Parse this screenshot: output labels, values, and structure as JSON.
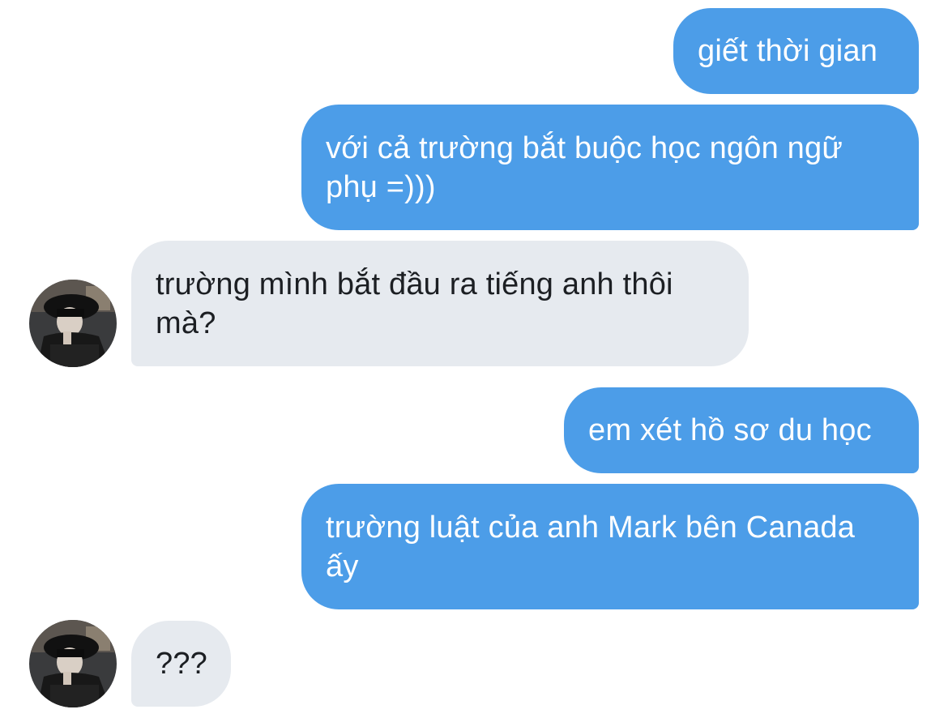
{
  "conversation": {
    "messages": [
      {
        "sender": "me",
        "text": "giết thời gian"
      },
      {
        "sender": "me",
        "text": "với cả trường bắt buộc học ngôn ngữ phụ =)))"
      },
      {
        "sender": "other",
        "text": "trường mình bắt đầu ra tiếng anh thôi mà?"
      },
      {
        "sender": "me",
        "text": "em xét hồ sơ du học"
      },
      {
        "sender": "me",
        "text": "trường luật của anh Mark bên Canada ấy"
      },
      {
        "sender": "other",
        "text": "???"
      }
    ]
  },
  "colors": {
    "sent_bubble": "#4c9de8",
    "received_bubble": "#e6eaef",
    "sent_text": "#ffffff",
    "received_text": "#1c1f23"
  }
}
